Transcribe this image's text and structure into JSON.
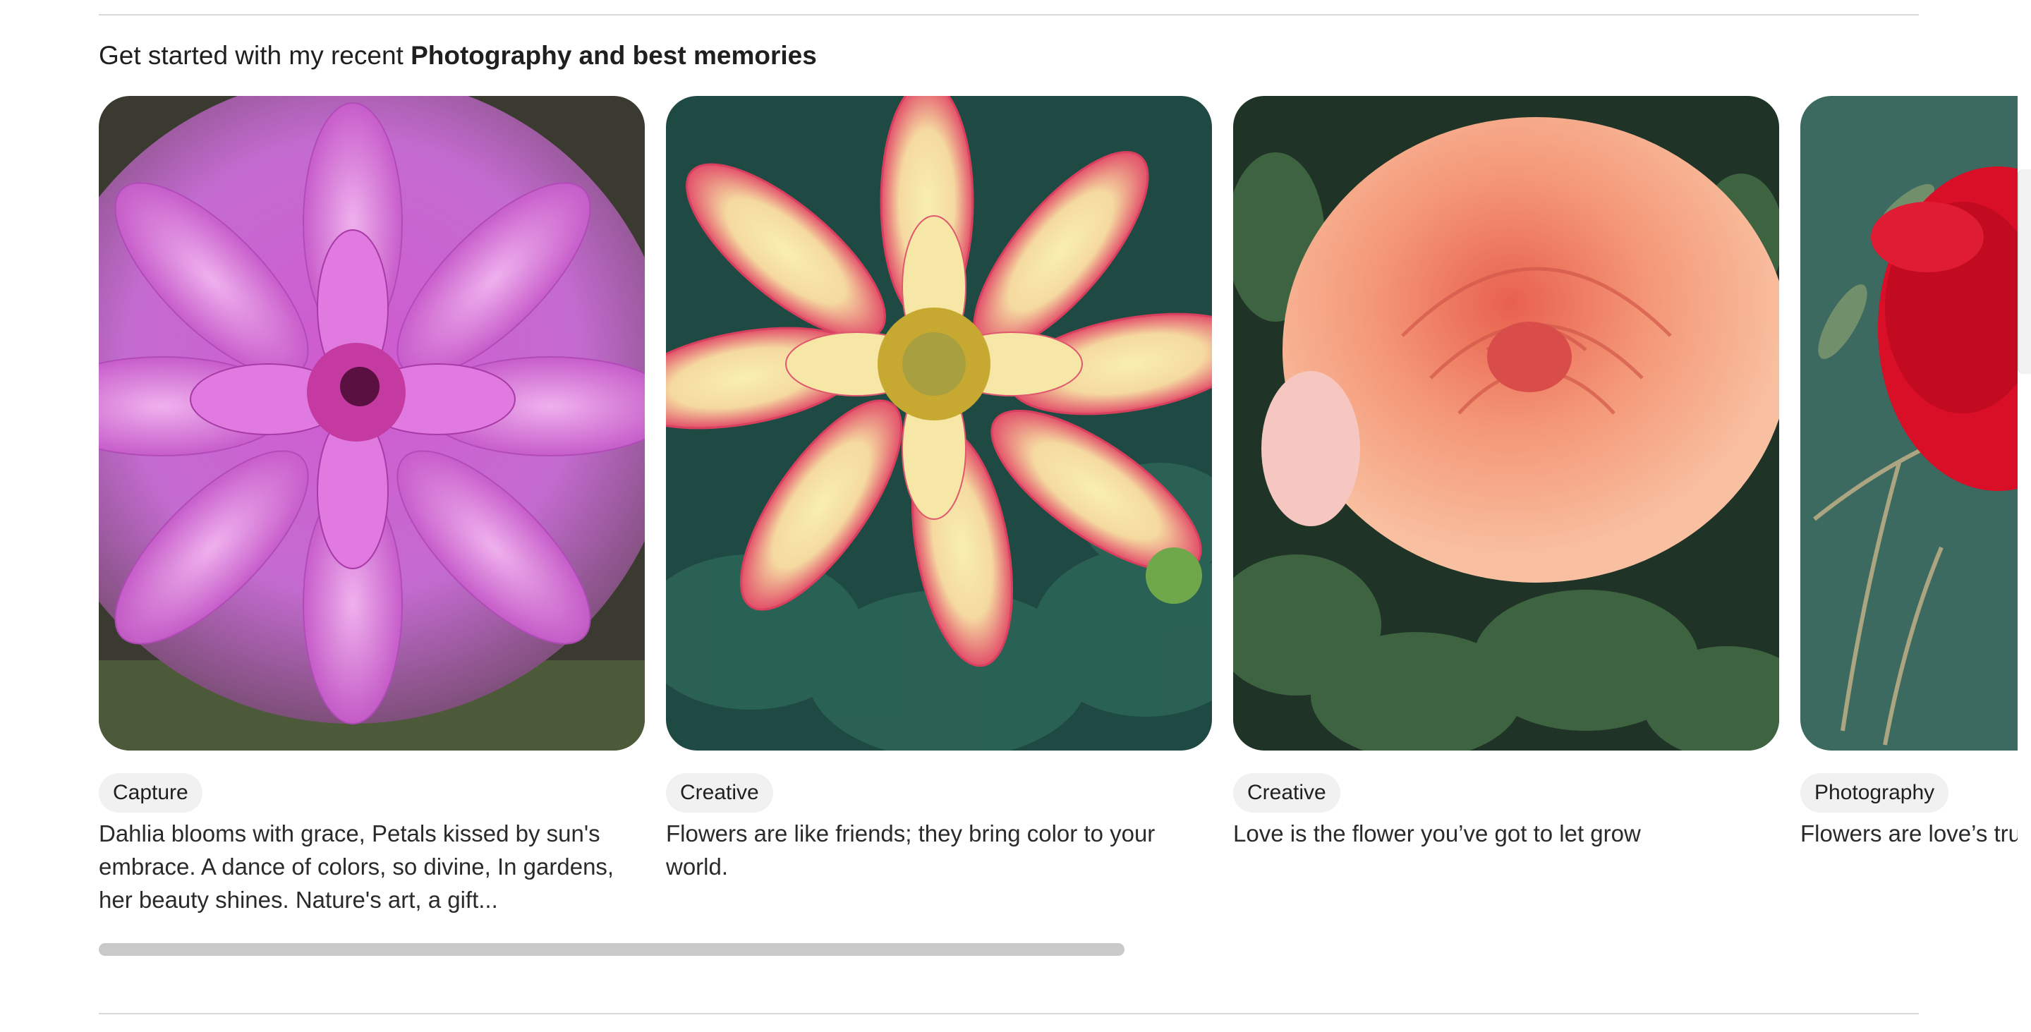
{
  "section": {
    "heading_prefix": "Get started with my recent ",
    "heading_bold": "Photography and best memories"
  },
  "cards": [
    {
      "tag": "Capture",
      "description": "Dahlia blooms with grace, Petals kissed by sun's embrace. A dance of colors, so divine, In gardens, her beauty shines. Nature's art, a gift...",
      "image": "pink-dahlia-photo"
    },
    {
      "tag": "Creative",
      "description": "Flowers are like friends; they bring color to your world.",
      "image": "yellow-red-dahlia-photo"
    },
    {
      "tag": "Creative",
      "description": "Love is the flower you’ve got to let grow",
      "image": "peach-rose-photo"
    },
    {
      "tag": "Photography",
      "description": "Flowers are love’s truest language",
      "image": "red-rose-photo"
    }
  ],
  "colors": {
    "tag_background": "#f1f1f1",
    "scrollbar": "#c9c9c9",
    "divider": "#d9d9d9"
  }
}
